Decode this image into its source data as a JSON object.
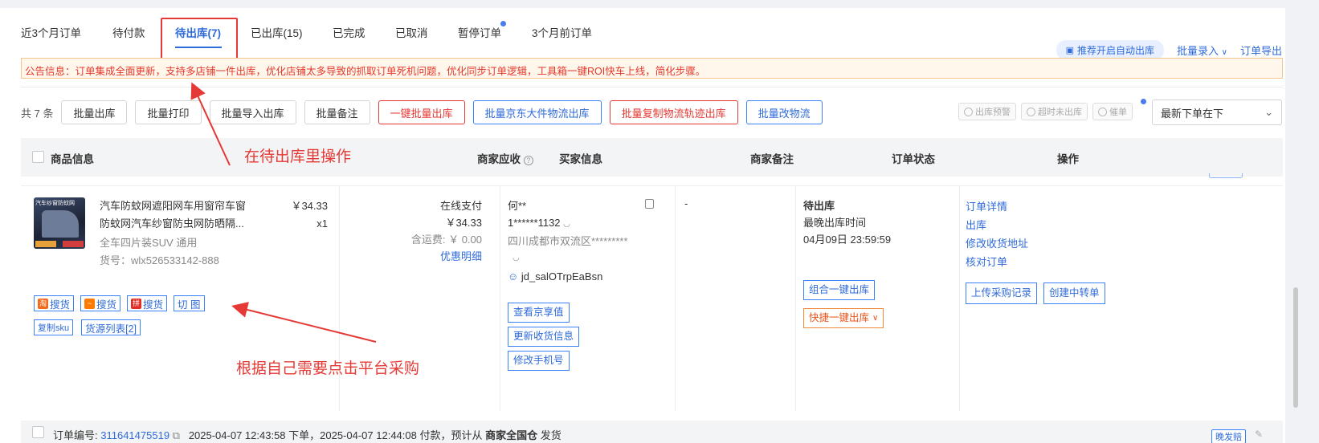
{
  "tabs": [
    {
      "label": "近3个月订单"
    },
    {
      "label": "待付款"
    },
    {
      "label": "待出库(7)"
    },
    {
      "label": "已出库(15)"
    },
    {
      "label": "已完成"
    },
    {
      "label": "已取消"
    },
    {
      "label": "暂停订单"
    },
    {
      "label": "3个月前订单"
    }
  ],
  "top_actions": {
    "auto_ship": "推荐开启自动出库",
    "batch_entry": "批量录入",
    "export": "订单导出"
  },
  "notice": "公告信息：订单集成全面更新，支持多店铺一件出库，优化店铺太多导致的抓取订单死机问题，优化同步订单逻辑，工具箱一键ROI快车上线，简化步骤。",
  "toolbar": {
    "count": "共 7 条",
    "buttons": [
      "批量出库",
      "批量打印",
      "批量导入出库",
      "批量备注",
      "一键批量出库",
      "批量京东大件物流出库",
      "批量复制物流轨迹出库",
      "批量改物流"
    ],
    "small_buttons": [
      "出库预警",
      "超时未出库",
      "催单"
    ],
    "sort": "最新下单在下"
  },
  "table_header": {
    "product": "商品信息",
    "receivable": "商家应收",
    "buyer": "买家信息",
    "remark": "商家备注",
    "status": "订单状态",
    "ops": "操作"
  },
  "order": {
    "thumb_title": "汽车纱窗防蚊网",
    "name_line1": "汽车防蚊网遮阳网车用窗帘车窗",
    "name_line2": "防蚊网汽车纱窗防虫网防晒隔...",
    "price": "￥34.33",
    "qty": "x1",
    "spec": "全车四片装SUV 通用",
    "sku_no": "货号：wlx526533142-888",
    "source_buttons": [
      "搜货",
      "搜货",
      "搜货",
      "切 图"
    ],
    "copy_sku": "复制sku",
    "source_list": "货源列表[2]",
    "pay_method": "在线支付",
    "pay_amount": "￥34.33",
    "shipping": "含运费: ￥ 0.00",
    "discount": "优惠明细",
    "buyer_name": "何**",
    "buyer_phone": "1******1132",
    "buyer_addr": "四川成都市双流区*********",
    "buyer_id": "jd_salOTrpEaBsn",
    "buyer_buttons": [
      "查看京享值",
      "更新收货信息",
      "修改手机号"
    ],
    "remark": "-",
    "status_title": "待出库",
    "status_sub": "最晚出库时间",
    "status_time": "04月09日 23:59:59",
    "combo_ship": "组合一键出库",
    "quick_ship": "快捷一键出库",
    "ops": [
      "订单详情",
      "出库",
      "修改收货地址",
      "核对订单"
    ],
    "ops_buttons": [
      "上传采购记录",
      "创建中转单"
    ]
  },
  "next_order": {
    "label": "订单编号:",
    "number": "311641475519",
    "detail": "2025-04-07 12:43:58 下单，2025-04-07 12:44:08 付款，预计从",
    "warehouse": "商家全国仓",
    "tail": "发货",
    "late_badge": "晚发赔"
  },
  "annotations": {
    "top": "在待出库里操作",
    "bottom": "根据自己需要点击平台采购"
  },
  "colors": {
    "accent": "#2f6bd9",
    "annotation": "#e53935",
    "notice_text": "#e5372b"
  }
}
